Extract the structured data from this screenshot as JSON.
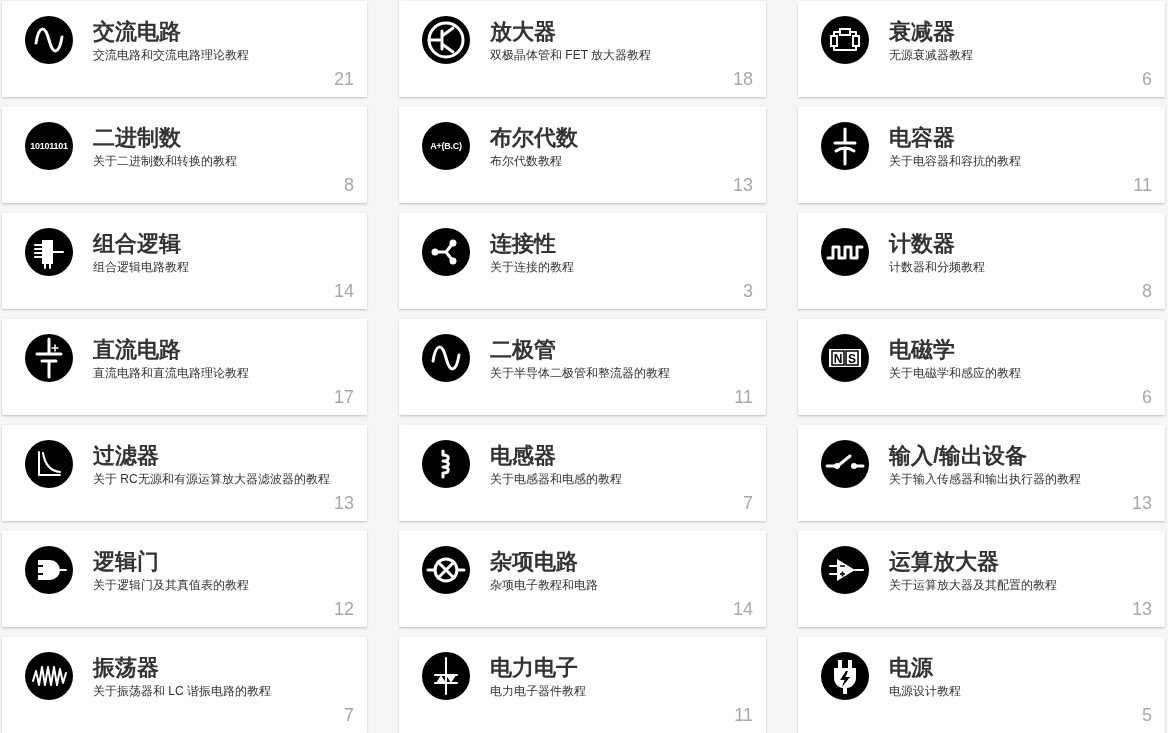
{
  "cards": [
    {
      "title": "交流电路",
      "description": "交流电路和交流电路理论教程",
      "count": "21"
    },
    {
      "title": "放大器",
      "description": "双极晶体管和 FET 放大器教程",
      "count": "18"
    },
    {
      "title": "衰减器",
      "description": "无源衰减器教程",
      "count": "6"
    },
    {
      "title": "二进制数",
      "description": "关于二进制数和转换的教程",
      "count": "8",
      "icon_text": [
        "10101101"
      ]
    },
    {
      "title": "布尔代数",
      "description": "布尔代数教程",
      "count": "13",
      "icon_text": [
        "A+(B.C)"
      ]
    },
    {
      "title": "电容器",
      "description": "关于电容器和容抗的教程",
      "count": "11"
    },
    {
      "title": "组合逻辑",
      "description": "组合逻辑电路教程",
      "count": "14"
    },
    {
      "title": "连接性",
      "description": "关于连接的教程",
      "count": "3"
    },
    {
      "title": "计数器",
      "description": "计数器和分频教程",
      "count": "8"
    },
    {
      "title": "直流电路",
      "description": "直流电路和直流电路理论教程",
      "count": "17"
    },
    {
      "title": "二极管",
      "description": "关于半导体二极管和整流器的教程",
      "count": "11"
    },
    {
      "title": "电磁学",
      "description": "关于电磁学和感应的教程",
      "count": "6",
      "icon_text": [
        "N",
        "S"
      ]
    },
    {
      "title": "过滤器",
      "description": "关于 RC无源和有源运算放大器滤波器的教程",
      "count": "13"
    },
    {
      "title": "电感器",
      "description": "关于电感器和电感的教程",
      "count": "7"
    },
    {
      "title": "输入/输出设备",
      "description": "关于输入传感器和输出执行器的教程",
      "count": "13"
    },
    {
      "title": "逻辑门",
      "description": "关于逻辑门及其真值表的教程",
      "count": "12"
    },
    {
      "title": "杂项电路",
      "description": "杂项电子教程和电路",
      "count": "14"
    },
    {
      "title": "运算放大器",
      "description": "关于运算放大器及其配置的教程",
      "count": "13"
    },
    {
      "title": "振荡器",
      "description": "关于振荡器和 LC 谐振电路的教程",
      "count": "7"
    },
    {
      "title": "电力电子",
      "description": "电力电子器件教程",
      "count": "11"
    },
    {
      "title": "电源",
      "description": "电源设计教程",
      "count": "5"
    }
  ]
}
